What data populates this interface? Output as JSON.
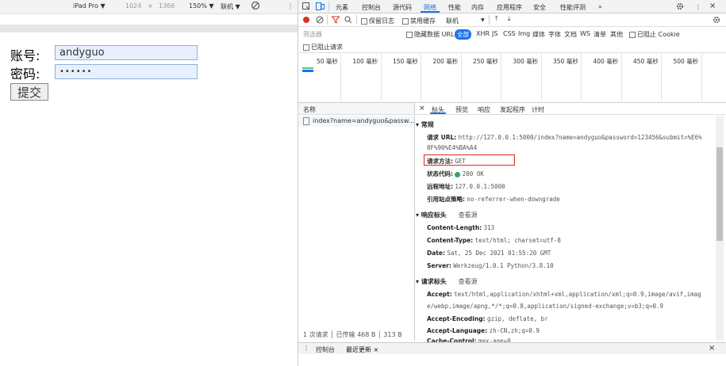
{
  "emulation": {
    "device": "iPad Pro ▼",
    "width": "1024",
    "x": "×",
    "height": "1366",
    "zoom": "150% ▼",
    "network": "联机 ▼",
    "more": "⋮"
  },
  "form": {
    "account_label": "账号:",
    "account_value": "andyguo",
    "password_label": "密码:",
    "password_value": "••••••",
    "submit_label": "提交"
  },
  "devtools": {
    "tabs": [
      "元素",
      "控制台",
      "源代码",
      "网络",
      "性能",
      "内存",
      "应用程序",
      "安全",
      "性能评测",
      "»"
    ],
    "active_tab": "网络",
    "toolbar": {
      "preserve_log": "保留日志",
      "disable_cache": "禁用缓存",
      "throttle": "联机",
      "throttle_arrow": "▼"
    },
    "filter": {
      "placeholder": "筛选器",
      "hide_data_urls": "隐藏数据 URL",
      "all": "全部",
      "types": [
        "XHR",
        "JS",
        "CSS",
        "Img",
        "媒体",
        "字体",
        "文档",
        "WS",
        "清单",
        "其他"
      ],
      "blocked_cookies": "已阻止 Cookie",
      "blocked_requests": "已阻止请求"
    },
    "timeline_ticks": [
      "50 毫秒",
      "100 毫秒",
      "150 毫秒",
      "200 毫秒",
      "250 毫秒",
      "300 毫秒",
      "350 毫秒",
      "400 毫秒",
      "450 毫秒",
      "500 毫秒"
    ],
    "request_list": {
      "header": "名称",
      "items": [
        "index?name=andyguo&passw..."
      ],
      "summary": "1 次请求 │ 已传输 468 B │ 313 B"
    },
    "detail_tabs": [
      "×",
      "标头",
      "预览",
      "响应",
      "发起程序",
      "计时"
    ],
    "general": {
      "title": "▾ 常规",
      "url_label": "请求 URL:",
      "url_value": "http://127.0.0.1:5000/index?name=andyguo&password=123456&submit=%E6%",
      "url_cont": "8F%90%E4%BA%A4",
      "method_label": "请求方法:",
      "method_value": "GET",
      "status_label": "状态代码:",
      "status_value": "200 OK",
      "remote_label": "远程地址:",
      "remote_value": "127.0.0.1:5000",
      "referrer_label": "引用站点策略:",
      "referrer_value": "no-referrer-when-downgrade"
    },
    "response_headers": {
      "title": "▾ 响应标头",
      "view_source": "查看源",
      "items": [
        {
          "k": "Content-Length:",
          "v": "313"
        },
        {
          "k": "Content-Type:",
          "v": "text/html; charset=utf-8"
        },
        {
          "k": "Date:",
          "v": "Sat, 25 Dec 2021 01:55:20 GMT"
        },
        {
          "k": "Server:",
          "v": "Werkzeug/1.0.1 Python/3.8.10"
        }
      ]
    },
    "request_headers": {
      "title": "▾ 请求标头",
      "view_source": "查看源",
      "accept_label": "Accept:",
      "accept_value": "text/html,application/xhtml+xml,application/xml;q=0.9,image/avif,imag",
      "accept_cont": "e/webp,image/apng,*/*;q=0.8,application/signed-exchange;v=b3;q=0.9",
      "encoding_label": "Accept-Encoding:",
      "encoding_value": "gzip, deflate, br",
      "language_label": "Accept-Language:",
      "language_value": "zh-CN,zh;q=0.9",
      "cache_label": "Cache-Control:",
      "cache_value": "max-age=0"
    },
    "drawer": {
      "menu": "⋮",
      "tabs": [
        "控制台",
        "最近更新 ×"
      ],
      "close": "×"
    },
    "colors": {
      "record": "#d93025",
      "accent": "#1a73e8",
      "highlight": "#e0291f"
    }
  }
}
